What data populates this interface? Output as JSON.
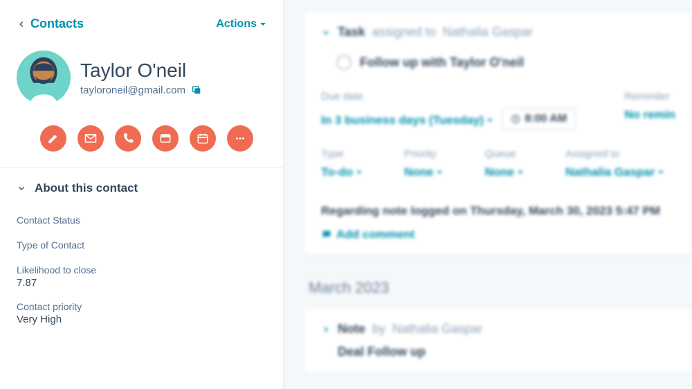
{
  "sidebar": {
    "back_label": "Contacts",
    "actions_label": "Actions",
    "contact_name": "Taylor O'neil",
    "contact_email": "tayloroneil@gmail.com",
    "about_header": "About this contact",
    "fields": [
      {
        "label": "Contact Status",
        "value": ""
      },
      {
        "label": "Type of Contact",
        "value": ""
      },
      {
        "label": "Likelihood to close",
        "value": "7.87"
      },
      {
        "label": "Contact priority",
        "value": "Very High"
      }
    ]
  },
  "main": {
    "task": {
      "task_label": "Task",
      "assigned_prefix": "assigned to",
      "assigned_name": "Nathalia Gaspar",
      "title": "Follow up with Taylor O'neil",
      "due_date_label": "Due date",
      "due_date_value": "In 3 business days (Tuesday)",
      "due_time": "8:00 AM",
      "reminder_label": "Reminder",
      "reminder_value": "No remin",
      "type_label": "Type",
      "type_value": "To-do",
      "priority_label": "Priority",
      "priority_value": "None",
      "queue_label": "Queue",
      "queue_value": "None",
      "assigned_to_label": "Assigned to",
      "assigned_to_value": "Nathalia Gaspar",
      "note_logged": "Regarding note logged on Thursday, March 30, 2023 5:47 PM",
      "add_comment": "Add comment"
    },
    "month_header": "March 2023",
    "note": {
      "note_label": "Note",
      "by_prefix": "by",
      "author": "Nathalia Gaspar",
      "title": "Deal Follow up"
    }
  }
}
